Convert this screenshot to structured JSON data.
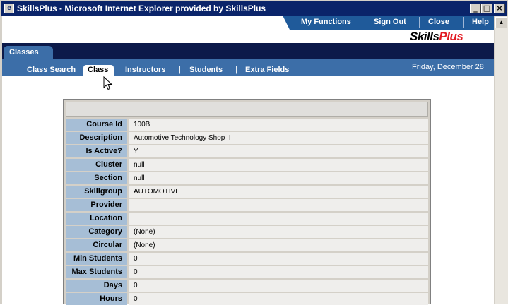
{
  "window": {
    "title": "SkillsPlus - Microsoft Internet Explorer provided by SkillsPlus",
    "icon": "ie-page-icon",
    "buttons": {
      "minimize": "_",
      "maximize": "□",
      "close": "×"
    }
  },
  "topnav": {
    "items": [
      "My Functions",
      "Sign Out",
      "Close",
      "Help"
    ]
  },
  "logo": {
    "skills": "Skills",
    "plus": "Plus"
  },
  "main_tab": "Classes",
  "subnav": {
    "items": [
      "Class Search",
      "Class",
      "Instructors",
      "Students",
      "Extra Fields"
    ],
    "active": "Class",
    "separator": "|"
  },
  "date": "Friday, December 28",
  "details": [
    {
      "label": "Course Id",
      "value": "100B"
    },
    {
      "label": "Description",
      "value": "Automotive Technology Shop II"
    },
    {
      "label": "Is Active?",
      "value": "Y"
    },
    {
      "label": "Cluster",
      "value": "null"
    },
    {
      "label": "Section",
      "value": "null"
    },
    {
      "label": "Skillgroup",
      "value": "AUTOMOTIVE"
    },
    {
      "label": "Provider",
      "value": ""
    },
    {
      "label": "Location",
      "value": ""
    },
    {
      "label": "Category",
      "value": "(None)"
    },
    {
      "label": "Circular",
      "value": "(None)"
    },
    {
      "label": "Min Students",
      "value": "0"
    },
    {
      "label": "Max Students",
      "value": "0"
    },
    {
      "label": "Days",
      "value": "0"
    },
    {
      "label": "Hours",
      "value": "0"
    }
  ],
  "colors": {
    "titlebar": "#0a246a",
    "nav_blue": "#3c6ea8",
    "dark_band": "#0c1a4a",
    "label_bg": "#a6bed6",
    "brand_red": "#e31b23"
  }
}
